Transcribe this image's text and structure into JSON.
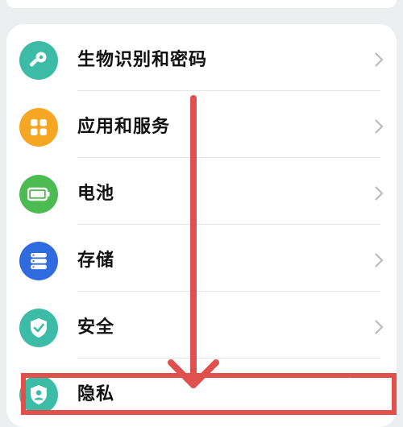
{
  "settings": {
    "items": [
      {
        "label": "生物识别和密码",
        "icon": "key-icon",
        "color": "#3cbca6"
      },
      {
        "label": "应用和服务",
        "icon": "apps-grid-icon",
        "color": "#f5a623"
      },
      {
        "label": "电池",
        "icon": "battery-icon",
        "color": "#4cbb52"
      },
      {
        "label": "存储",
        "icon": "storage-icon",
        "color": "#2f6bdf"
      },
      {
        "label": "安全",
        "icon": "shield-check-icon",
        "color": "#3cbca6"
      },
      {
        "label": "隐私",
        "icon": "privacy-shield-icon",
        "color": "#3cbca6"
      }
    ]
  },
  "annotation": {
    "highlight_color": "#e0504d",
    "arrow_color": "#e0504d"
  }
}
